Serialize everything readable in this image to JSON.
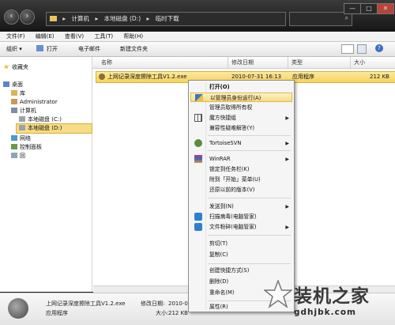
{
  "address": {
    "segments": [
      "▸",
      "计算机",
      "▸",
      "本地磁盘 (D:)",
      "▸",
      "临时下载"
    ]
  },
  "window_buttons": [
    "—",
    "□",
    "✕"
  ],
  "menubar": [
    "文件(F)",
    "编辑(E)",
    "查看(V)",
    "工具(T)",
    "帮助(H)"
  ],
  "toolbar": {
    "organize": "组织 ▾",
    "open": "打开",
    "email": "电子邮件",
    "new_folder": "新建文件夹"
  },
  "nav": {
    "favorites": "收藏夹",
    "desktop": "桌面",
    "library": "库",
    "user": "Administrator",
    "computer": "计算机",
    "drive_c": "本地磁盘 (C:)",
    "drive_d": "本地磁盘 (D:)",
    "network": "网络",
    "control_panel": "控制面板",
    "recycle": "回"
  },
  "columns": {
    "name": "名称",
    "date": "修改日期",
    "type": "类型",
    "size": "大小"
  },
  "file": {
    "name": "上网记录深度擦除工具V1.2.exe",
    "date": "2010-07-31 16:13",
    "type": "应用程序",
    "size": "212 KB"
  },
  "context_menu": {
    "open": "打开(O)",
    "run_as_admin": "以管理员身份运行(A)",
    "take_ownership": "管理员取得所有权",
    "magic_shortcut": "魔方快捷组",
    "compat": "兼容性疑难解答(Y)",
    "tortoise": "TortoiseSVN",
    "winrar": "WinRAR",
    "pin_taskbar": "锁定到任务栏(K)",
    "pin_start": "附到「开始」菜单(U)",
    "restore": "还原以前的版本(V)",
    "send_to": "发送到(N)",
    "scan_virus": "扫描病毒(电脑管家)",
    "shred": "文件粉碎(电脑管家)",
    "cut": "剪切(T)",
    "copy": "复制(C)",
    "create_shortcut": "创建快捷方式(S)",
    "delete": "删除(D)",
    "rename": "重命名(M)",
    "properties": "属性(R)"
  },
  "details": {
    "name": "上网记录深度擦除工具V1.2.exe",
    "date_label": "修改日期:",
    "date_value": "2010-07-",
    "type": "应用程序",
    "size_label": "大小:",
    "size_value": "212 KB"
  },
  "watermark": {
    "line1": "装机之家",
    "line2": "gdhjbk.com"
  },
  "colors": {
    "selection": "#f5d35a",
    "titlebar": "#161616",
    "menu_highlight": "#f7dc86"
  }
}
